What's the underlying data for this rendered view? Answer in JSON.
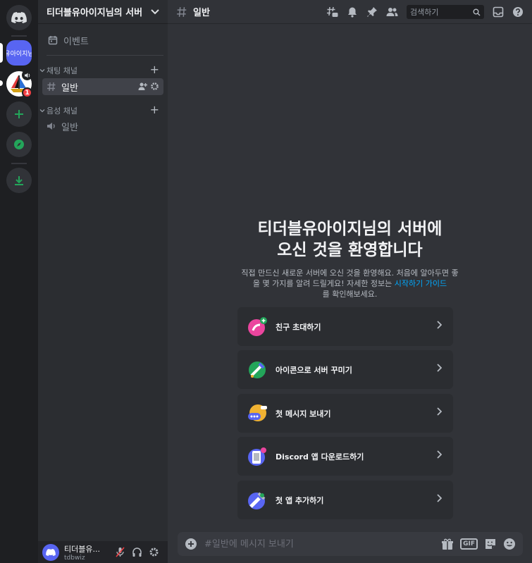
{
  "server": {
    "name": "티더블유아이지님의 서버",
    "active_label": "유아이지님"
  },
  "badges": {
    "mentions": "1"
  },
  "sidebar": {
    "events_label": "이벤트",
    "categories": [
      {
        "name": "채팅 채널",
        "channels": [
          "일반"
        ]
      },
      {
        "name": "음성 채널",
        "channels": [
          "일반"
        ]
      }
    ]
  },
  "topbar": {
    "channel": "일반",
    "search_placeholder": "검색하기"
  },
  "welcome": {
    "title_line1": "티더블유아이지님의 서버에",
    "title_line2": "오신 것을 환영합니다",
    "desc_part1": "직접 만드신 새로운 서버에 오신 것을 환영해요. 처음에 알아두면 좋을 몇 가지를 알려    드릴게요! 자세한 정보는",
    "desc_link": "시작하기 가이드",
    "desc_part2": "를 확인해보세요."
  },
  "cards": [
    {
      "label": "친구 초대하기",
      "icon": "invite-friend-icon"
    },
    {
      "label": "아이콘으로 서버 꾸미기",
      "icon": "customize-icon"
    },
    {
      "label": "첫 메시지 보내기",
      "icon": "message-icon"
    },
    {
      "label": "Discord 앱 다운로드하기",
      "icon": "download-app-icon"
    },
    {
      "label": "첫 앱 추가하기",
      "icon": "add-app-icon"
    }
  ],
  "composer": {
    "placeholder": "#일반에 메시지 보내기"
  },
  "user": {
    "name": "티더블유...",
    "status": "tdbwiz"
  },
  "colors": {
    "blurple": "#5865f2",
    "link": "#00a8fc",
    "danger": "#f23f43",
    "green": "#23a55a"
  }
}
